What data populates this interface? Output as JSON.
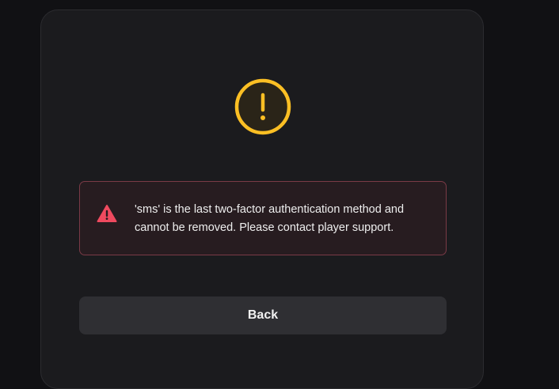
{
  "status": {
    "icon": "exclamation-circle-icon",
    "color": "#fbbf24"
  },
  "alert": {
    "icon": "warning-triangle-icon",
    "icon_color": "#ef4a5f",
    "message": "'sms' is the last two-factor authentication method and cannot be removed. Please contact player support."
  },
  "actions": {
    "back_label": "Back"
  }
}
